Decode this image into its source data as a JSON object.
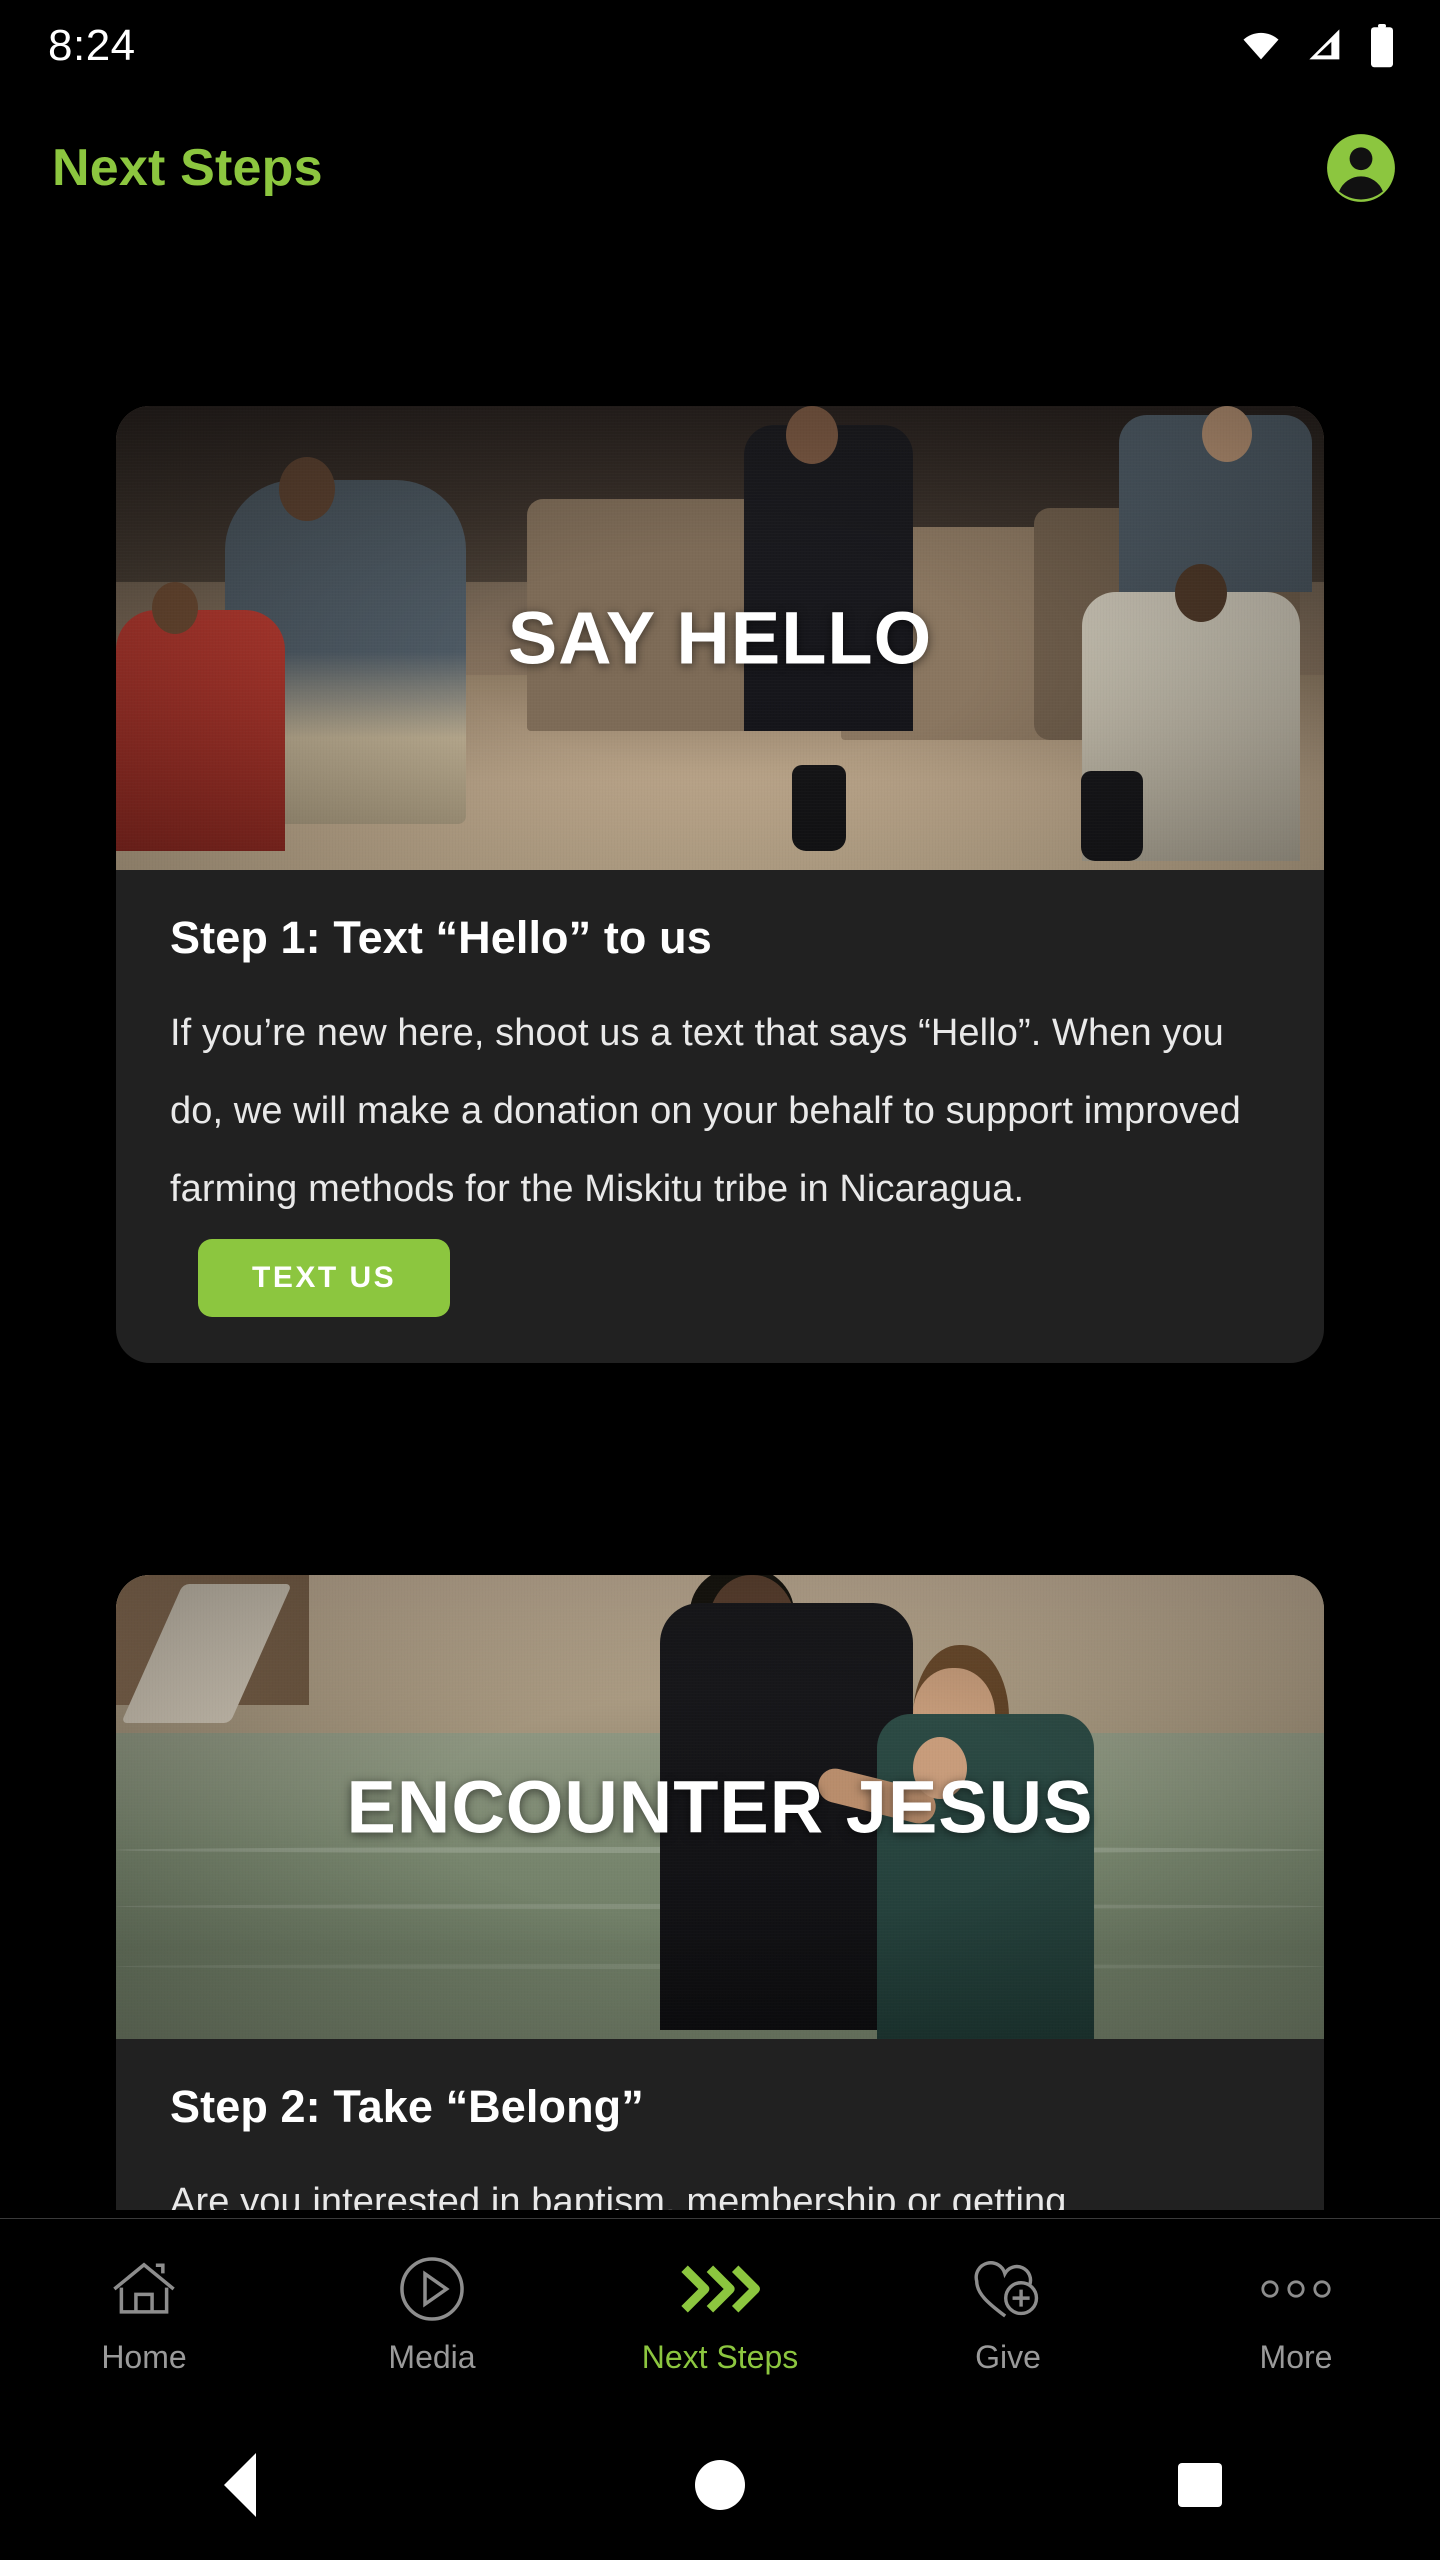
{
  "status_bar": {
    "time": "8:24",
    "icons": [
      "wifi-icon",
      "cellular-signal-icon",
      "battery-icon"
    ]
  },
  "header": {
    "title": "Next Steps",
    "avatar_icon": "account-circle-icon",
    "accent_color": "#8cc63f"
  },
  "cards": [
    {
      "hero_overlay": "SAY HELLO",
      "title": "Step 1: Text “Hello” to us",
      "description": "If you’re new here, shoot us a text that says “Hello”. When you do, we will make a donation on your behalf to support improved farming methods for the Miskitu tribe in Nicaragua.",
      "button_label": "TEXT US"
    },
    {
      "hero_overlay": "ENCOUNTER JESUS",
      "title": "Step 2: Take “Belong”",
      "description": "Are you interested in baptism, membership or getting",
      "button_label": ""
    }
  ],
  "bottom_nav": {
    "active": "Next Steps",
    "items": [
      {
        "label": "Home",
        "icon": "home-icon"
      },
      {
        "label": "Media",
        "icon": "play-circle-icon"
      },
      {
        "label": "Next Steps",
        "icon": "double-chevron-right-icon"
      },
      {
        "label": "Give",
        "icon": "heart-plus-icon"
      },
      {
        "label": "More",
        "icon": "more-dots-icon"
      }
    ]
  },
  "system_nav": {
    "back": "back-button",
    "home": "home-button",
    "recents": "recents-button"
  }
}
